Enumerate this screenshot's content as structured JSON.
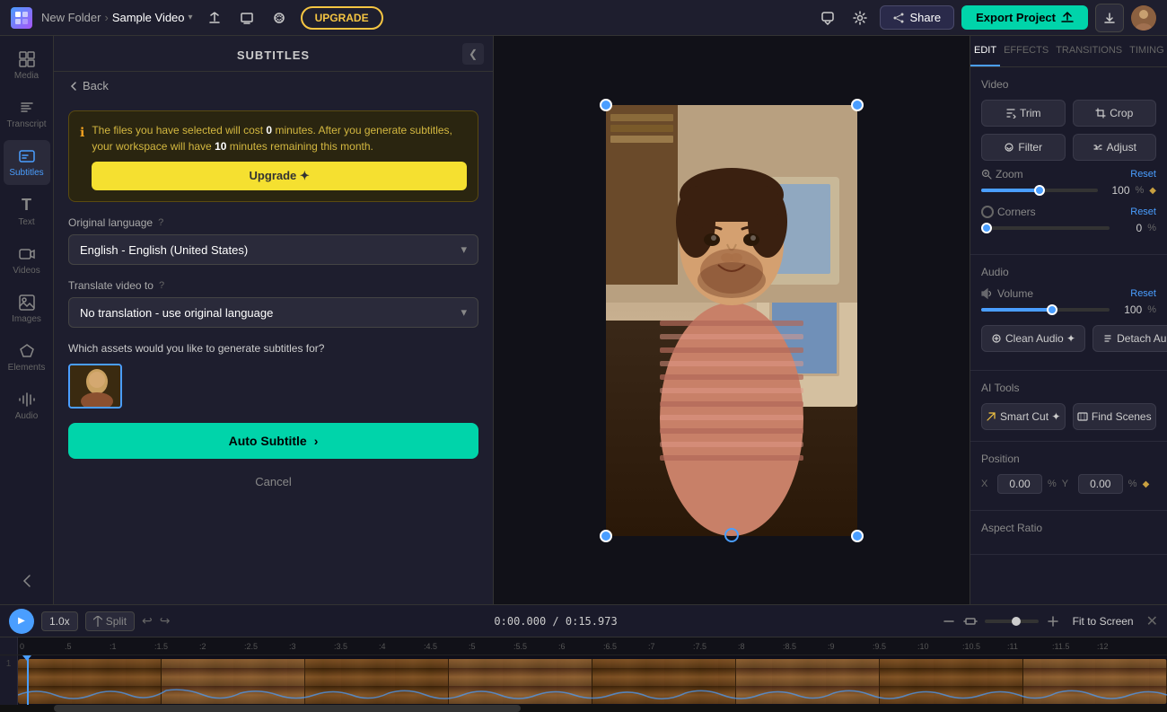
{
  "topbar": {
    "folder_name": "New Folder",
    "chevron": "›",
    "file_name": "Sample Video",
    "dropdown_arrow": "▾",
    "upgrade_label": "UPGRADE",
    "share_label": "Share",
    "export_label": "Export Project",
    "export_icon": "↑"
  },
  "left_sidebar": {
    "items": [
      {
        "id": "media",
        "icon": "⊞",
        "label": "Media"
      },
      {
        "id": "transcript",
        "icon": "≡",
        "label": "Transcript"
      },
      {
        "id": "subtitles",
        "icon": "⊡",
        "label": "Subtitles",
        "active": true
      },
      {
        "id": "text",
        "icon": "T",
        "label": "Text"
      },
      {
        "id": "videos",
        "icon": "▶",
        "label": "Videos"
      },
      {
        "id": "images",
        "icon": "🖼",
        "label": "Images"
      },
      {
        "id": "elements",
        "icon": "✦",
        "label": "Elements"
      },
      {
        "id": "audio",
        "icon": "♪",
        "label": "Audio"
      }
    ]
  },
  "subtitles_panel": {
    "title": "SUBTITLES",
    "back_label": "Back",
    "info_message_part1": "The files you have selected will cost ",
    "info_cost": "0",
    "info_message_part2": " minutes. After you generate subtitles, your workspace will have ",
    "info_remaining": "10",
    "info_message_part3": " minutes remaining this month.",
    "upgrade_btn_label": "Upgrade ✦",
    "original_language_label": "Original language",
    "original_language_value": "English - English (United States)",
    "translate_label": "Translate video to",
    "translate_value": "No translation - use original language",
    "assets_question": "Which assets would you like to generate subtitles for?",
    "auto_subtitle_label": "Auto Subtitle",
    "auto_subtitle_arrow": "›",
    "cancel_label": "Cancel"
  },
  "right_panel": {
    "tabs": [
      {
        "id": "edit",
        "label": "EDIT",
        "active": true
      },
      {
        "id": "effects",
        "label": "EFFECTS",
        "active": false
      },
      {
        "id": "transitions",
        "label": "TRANSITIONS",
        "active": false
      },
      {
        "id": "timing",
        "label": "TIMING",
        "active": false
      }
    ],
    "video_section_title": "Video",
    "trim_label": "Trim",
    "crop_label": "Crop",
    "filter_label": "Filter",
    "adjust_label": "Adjust",
    "zoom_label": "Zoom",
    "zoom_reset": "Reset",
    "zoom_value": "100",
    "zoom_unit": "%",
    "zoom_percent": 100,
    "corners_label": "Corners",
    "corners_reset": "Reset",
    "corners_value": "0",
    "corners_unit": "%",
    "audio_section_title": "Audio",
    "volume_label": "Volume",
    "volume_reset": "Reset",
    "volume_value": "100",
    "volume_unit": "%",
    "volume_percent": 55,
    "clean_audio_label": "Clean Audio ✦",
    "detach_audio_label": "Detach Audio",
    "ai_tools_title": "AI Tools",
    "smart_cut_label": "Smart Cut ✦",
    "find_scenes_label": "Find Scenes",
    "position_title": "Position",
    "pos_x_label": "X",
    "pos_x_value": "0.00",
    "pos_x_unit": "%",
    "pos_y_label": "Y",
    "pos_y_value": "0.00",
    "pos_y_unit": "%",
    "aspect_ratio_title": "Aspect Ratio"
  },
  "timeline": {
    "speed_label": "1.0x",
    "split_label": "Split",
    "timecode": "0:00.000",
    "total_time": "0:15.973",
    "fit_screen_label": "Fit to Screen",
    "ruler_marks": [
      "0",
      ".5",
      ":1",
      ":1.5",
      ":2",
      ":2.5",
      ":3",
      ":3.5",
      ":4",
      ":4.5",
      ":5",
      ":5.5",
      ":6",
      ":6.5",
      ":7",
      ":7.5",
      ":8",
      ":8.5",
      ":9",
      ":9.5",
      ":10",
      ":10.5",
      ":11",
      ":11.5",
      ":12"
    ],
    "track_number": "1"
  },
  "colors": {
    "accent": "#4a9eff",
    "teal": "#00d4aa",
    "yellow": "#f5e030",
    "brand_gradient_start": "#4a9eff",
    "brand_gradient_end": "#a855f7"
  }
}
